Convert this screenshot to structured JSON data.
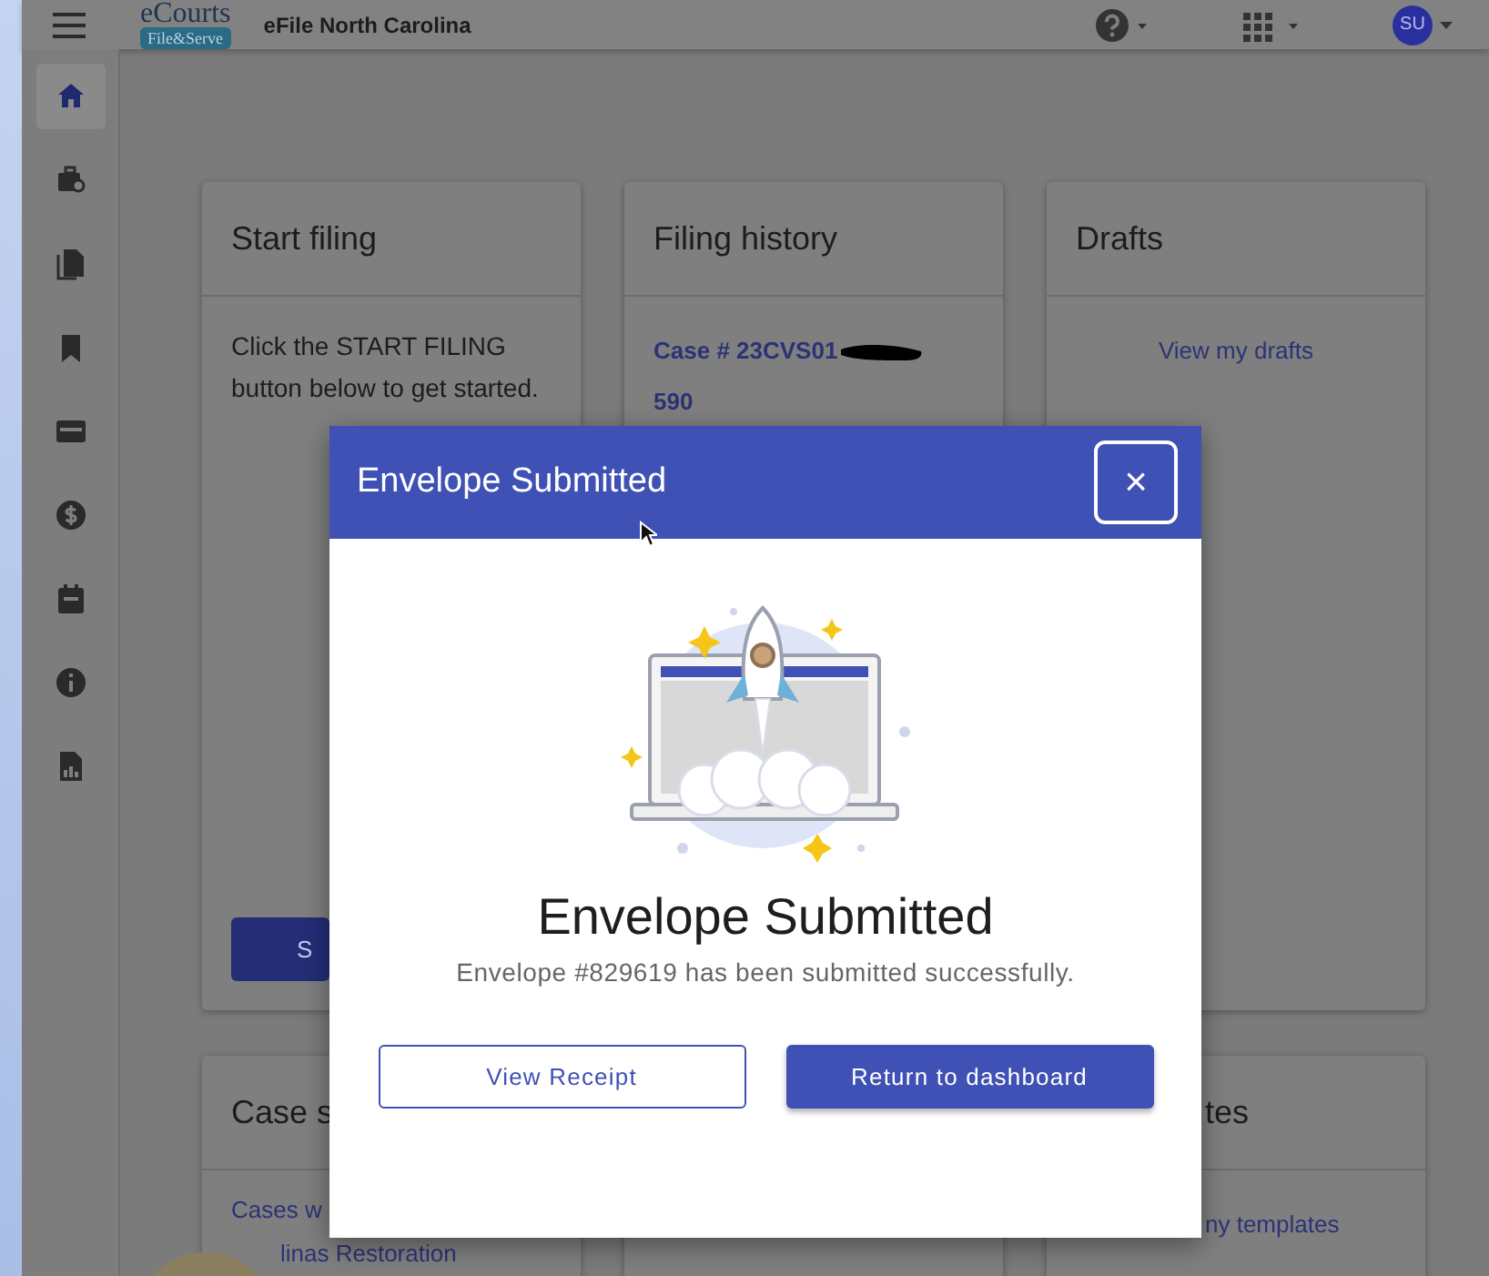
{
  "header": {
    "logo_top": "eCourts",
    "logo_badge": "File&Serve",
    "title": "eFile North Carolina",
    "avatar": "SU"
  },
  "sidebar": {
    "items": [
      {
        "selected": true
      },
      {
        "selected": false
      },
      {
        "selected": false
      },
      {
        "selected": false
      },
      {
        "selected": false
      },
      {
        "selected": false
      },
      {
        "selected": false
      },
      {
        "selected": false
      },
      {
        "selected": false
      }
    ]
  },
  "cards": [
    {
      "title": "Start filing",
      "text": "Click the START FILING button below to get started.",
      "button": "S"
    },
    {
      "title": "Filing history",
      "case_link": "Case # 23CVS01",
      "case_link_2": "590"
    },
    {
      "title": "Drafts",
      "link": "View my drafts"
    },
    {
      "title": "Case s",
      "links": [
        "Cases w",
        "linas Restoration"
      ]
    },
    {
      "title": "tes",
      "link": "ny templates"
    }
  ],
  "modal": {
    "title": "Envelope Submitted",
    "close": "×",
    "heading": "Envelope Submitted",
    "message": "Envelope #829619 has been submitted successfully.",
    "buttons": [
      {
        "label": "View Receipt",
        "kind": "outlined"
      },
      {
        "label": "Return to dashboard",
        "kind": "filled"
      }
    ]
  }
}
